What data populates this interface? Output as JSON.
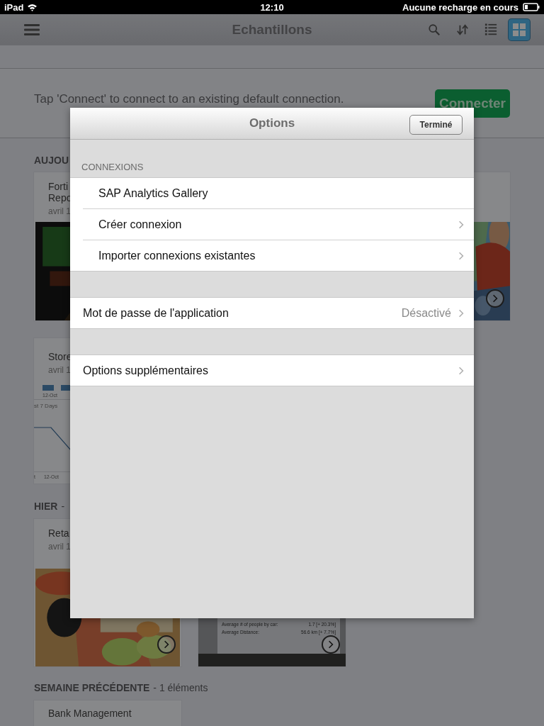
{
  "status_bar": {
    "carrier": "iPad",
    "time": "12:10",
    "battery_text": "Aucune recharge en cours"
  },
  "nav_bar": {
    "title": "Echantillons",
    "toolbar": [
      {
        "kind": "search",
        "selected": false
      },
      {
        "kind": "sort",
        "selected": false
      },
      {
        "kind": "list",
        "selected": false
      },
      {
        "kind": "grid",
        "selected": true
      }
    ]
  },
  "connect_bar": {
    "message": "Tap 'Connect' to connect to an existing default connection.",
    "button": "Connecter"
  },
  "sections": [
    {
      "title": "AUJOU",
      "cards": [
        {
          "kind": "report",
          "title": "Forti Repo",
          "date": "avril 1"
        },
        {
          "kind": "picture_only",
          "next": true
        },
        {
          "kind": "chart",
          "title": "Store",
          "date": "avril 1",
          "top_labels": [
            "12-Oct"
          ],
          "caption": "st 7 Days",
          "bottom_labels": [
            "t",
            "12-Oct"
          ]
        }
      ]
    },
    {
      "title": "HIER",
      "count": "-",
      "cards": [
        {
          "kind": "report",
          "title": "Reta",
          "date": "avril 1",
          "next": true
        },
        {
          "kind": "stats",
          "stats": [
            {
              "label": "Average # of people by car:",
              "value": "1.7 [+ 20.3%]"
            },
            {
              "label": "Average Distance:",
              "value": "56.6 km [+ 7.7%]"
            }
          ],
          "next": true
        }
      ]
    },
    {
      "title": "SEMAINE PRÉCÉDENTE",
      "count": "- 1 éléments",
      "cards": [
        {
          "kind": "title_only",
          "title": "Bank Management"
        }
      ]
    }
  ],
  "options_dialog": {
    "title": "Options",
    "done_button": "Terminé",
    "groups": [
      {
        "header": "CONNEXIONS",
        "indented": true,
        "rows": [
          {
            "label": "SAP Analytics Gallery",
            "chevron": false
          },
          {
            "label": "Créer connexion",
            "chevron": true
          },
          {
            "label": "Importer connexions existantes",
            "chevron": true
          }
        ]
      },
      {
        "indented": false,
        "rows": [
          {
            "label": "Mot de passe de l'application",
            "value": "Désactivé",
            "chevron": true
          }
        ]
      },
      {
        "indented": false,
        "rows": [
          {
            "label": "Options supplémentaires",
            "chevron": true
          }
        ]
      }
    ]
  }
}
